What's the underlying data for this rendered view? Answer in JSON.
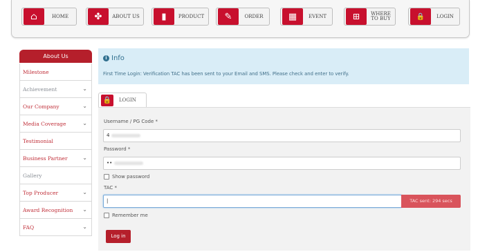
{
  "nav": {
    "items": [
      {
        "label": "HOME",
        "icon": "home-icon",
        "glyph": "⌂"
      },
      {
        "label": "ABOUT US",
        "icon": "people-icon",
        "glyph": "✤"
      },
      {
        "label": "PRODUCT",
        "icon": "product-icon",
        "glyph": "▮"
      },
      {
        "label": "ORDER",
        "icon": "order-icon",
        "glyph": "✎"
      },
      {
        "label": "EVENT",
        "icon": "calendar-icon",
        "glyph": "▦"
      },
      {
        "label": "WHERE TO BUY",
        "icon": "cart-icon",
        "glyph": "⊞"
      },
      {
        "label": "LOGIN",
        "icon": "lock-icon",
        "glyph": "🔒"
      }
    ]
  },
  "sidebar": {
    "title": "About Us",
    "items": [
      {
        "label": "Milestone"
      },
      {
        "label": "Achievement",
        "chevron": "⌄"
      },
      {
        "label": "Our Company",
        "chevron": "⌄"
      },
      {
        "label": "Media Coverage",
        "chevron": "⌄"
      },
      {
        "label": "Testimonial"
      },
      {
        "label": "Business Partner",
        "chevron": "⌄"
      },
      {
        "label": "Gallery"
      },
      {
        "label": "Top Producer",
        "chevron": "⌄"
      },
      {
        "label": "Award Recognition",
        "chevron": "⌄"
      },
      {
        "label": "FAQ",
        "chevron": "⌄"
      }
    ]
  },
  "info": {
    "title": "Info",
    "icon_glyph": "i",
    "message": "First Time Login: Verification TAC has been sent to your Email and SMS. Please check and enter to verify."
  },
  "tab": {
    "label": "LOGIN",
    "glyph": "🔒"
  },
  "form": {
    "username_label": "Username / PG Code *",
    "username_value": "4",
    "password_label": "Password *",
    "password_value": "••",
    "show_password_label": "Show password",
    "tac_label": "TAC *",
    "tac_value": "|",
    "tac_badge": "TAC sent: 294 secs",
    "remember_label": "Remember me",
    "submit_label": "Log in"
  },
  "colors": {
    "brand_red": "#b51f2b",
    "icon_red": "#c8102e",
    "info_bg": "#d9edf7",
    "badge_red": "#d9545c"
  }
}
